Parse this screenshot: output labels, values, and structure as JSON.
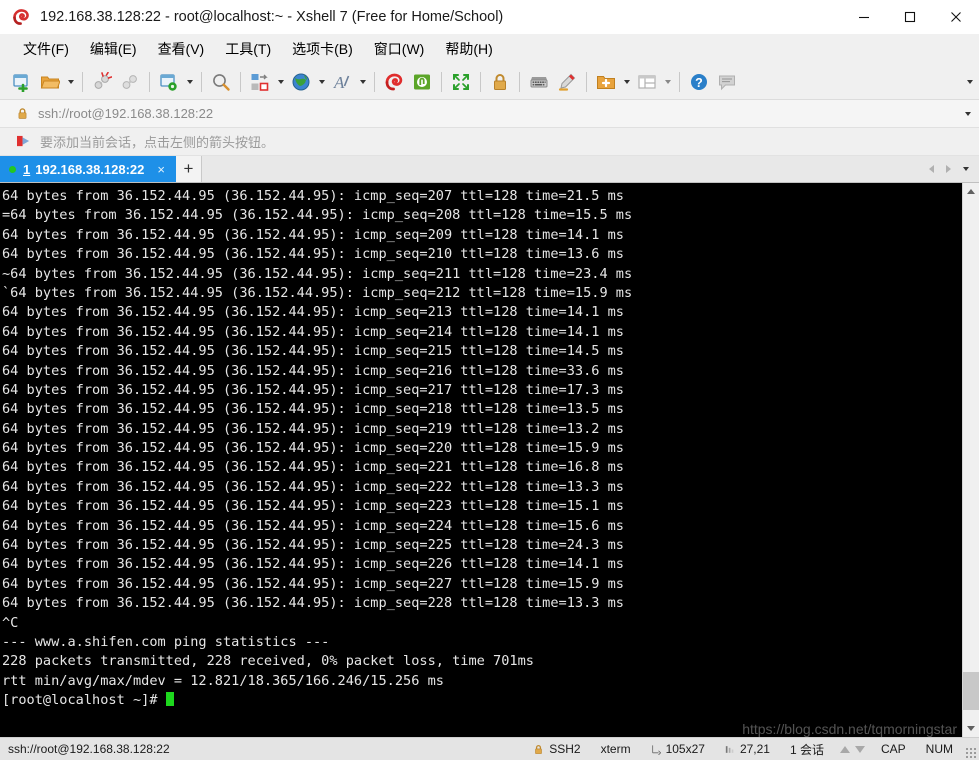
{
  "window": {
    "title": "192.168.38.128:22 - root@localhost:~ - Xshell 7 (Free for Home/School)",
    "minimize_label": "—",
    "maximize_label": "□",
    "close_label": "✕"
  },
  "menubar": {
    "items": [
      {
        "label": "文件(F)",
        "name": "menu-file"
      },
      {
        "label": "编辑(E)",
        "name": "menu-edit"
      },
      {
        "label": "查看(V)",
        "name": "menu-view"
      },
      {
        "label": "工具(T)",
        "name": "menu-tools"
      },
      {
        "label": "选项卡(B)",
        "name": "menu-tabs"
      },
      {
        "label": "窗口(W)",
        "name": "menu-window"
      },
      {
        "label": "帮助(H)",
        "name": "menu-help"
      }
    ]
  },
  "toolbar": {
    "buttons": [
      "new-session-icon",
      "open-folder-icon",
      "open-folder-caret",
      "sep",
      "disconnect-icon",
      "reconnect-icon",
      "sep",
      "session-properties-icon",
      "session-properties-caret",
      "sep",
      "find-icon",
      "sep",
      "transfer-icon",
      "transfer-caret",
      "globe-icon",
      "globe-caret",
      "font-icon",
      "font-caret",
      "sep",
      "xshell-icon",
      "xftp-icon",
      "sep",
      "fullscreen-icon",
      "sep",
      "lock-icon",
      "sep",
      "keyboard-icon",
      "highlight-icon",
      "sep",
      "add-folder-icon",
      "add-folder-caret",
      "layout-icon",
      "layout-caret",
      "sep",
      "help-icon",
      "chat-icon"
    ],
    "overflow_label": "▼"
  },
  "address": {
    "lock_icon": "lock-icon",
    "url": "ssh://root@192.168.38.128:22",
    "dropdown_label": "▼"
  },
  "hint": {
    "icon": "arrow-flag-icon",
    "text": "要添加当前会话，点击左侧的箭头按钮。"
  },
  "tabs": {
    "active": {
      "index": "1",
      "label": "192.168.38.128:22",
      "close_label": "×",
      "status": "connected"
    },
    "new_tab_label": "+",
    "nav_prev": "◀",
    "nav_next": "▶",
    "menu_caret": "▼"
  },
  "terminal": {
    "lines": [
      "64 bytes from 36.152.44.95 (36.152.44.95): icmp_seq=207 ttl=128 time=21.5 ms",
      "=64 bytes from 36.152.44.95 (36.152.44.95): icmp_seq=208 ttl=128 time=15.5 ms",
      "64 bytes from 36.152.44.95 (36.152.44.95): icmp_seq=209 ttl=128 time=14.1 ms",
      "64 bytes from 36.152.44.95 (36.152.44.95): icmp_seq=210 ttl=128 time=13.6 ms",
      "~64 bytes from 36.152.44.95 (36.152.44.95): icmp_seq=211 ttl=128 time=23.4 ms",
      "`64 bytes from 36.152.44.95 (36.152.44.95): icmp_seq=212 ttl=128 time=15.9 ms",
      "64 bytes from 36.152.44.95 (36.152.44.95): icmp_seq=213 ttl=128 time=14.1 ms",
      "64 bytes from 36.152.44.95 (36.152.44.95): icmp_seq=214 ttl=128 time=14.1 ms",
      "64 bytes from 36.152.44.95 (36.152.44.95): icmp_seq=215 ttl=128 time=14.5 ms",
      "64 bytes from 36.152.44.95 (36.152.44.95): icmp_seq=216 ttl=128 time=33.6 ms",
      "64 bytes from 36.152.44.95 (36.152.44.95): icmp_seq=217 ttl=128 time=17.3 ms",
      "64 bytes from 36.152.44.95 (36.152.44.95): icmp_seq=218 ttl=128 time=13.5 ms",
      "64 bytes from 36.152.44.95 (36.152.44.95): icmp_seq=219 ttl=128 time=13.2 ms",
      "64 bytes from 36.152.44.95 (36.152.44.95): icmp_seq=220 ttl=128 time=15.9 ms",
      "64 bytes from 36.152.44.95 (36.152.44.95): icmp_seq=221 ttl=128 time=16.8 ms",
      "64 bytes from 36.152.44.95 (36.152.44.95): icmp_seq=222 ttl=128 time=13.3 ms",
      "64 bytes from 36.152.44.95 (36.152.44.95): icmp_seq=223 ttl=128 time=15.1 ms",
      "64 bytes from 36.152.44.95 (36.152.44.95): icmp_seq=224 ttl=128 time=15.6 ms",
      "64 bytes from 36.152.44.95 (36.152.44.95): icmp_seq=225 ttl=128 time=24.3 ms",
      "64 bytes from 36.152.44.95 (36.152.44.95): icmp_seq=226 ttl=128 time=14.1 ms",
      "64 bytes from 36.152.44.95 (36.152.44.95): icmp_seq=227 ttl=128 time=15.9 ms",
      "64 bytes from 36.152.44.95 (36.152.44.95): icmp_seq=228 ttl=128 time=13.3 ms",
      "^C",
      "--- www.a.shifen.com ping statistics ---",
      "228 packets transmitted, 228 received, 0% packet loss, time 701ms",
      "rtt min/avg/max/mdev = 12.821/18.365/166.246/15.256 ms"
    ],
    "prompt": "[root@localhost ~]# ",
    "fg_color": "#e6e6e6",
    "bg_color": "#000000",
    "cursor_color": "#1dd81d"
  },
  "watermark": {
    "text": "https://blog.csdn.net/tqmorningstar"
  },
  "statusbar": {
    "connection": "ssh://root@192.168.38.128:22",
    "protocol": "SSH2",
    "term_type": "xterm",
    "size": "105x27",
    "cursor_pos": "27,21",
    "sessions": "1 会话",
    "caps": "CAP",
    "num": "NUM"
  }
}
